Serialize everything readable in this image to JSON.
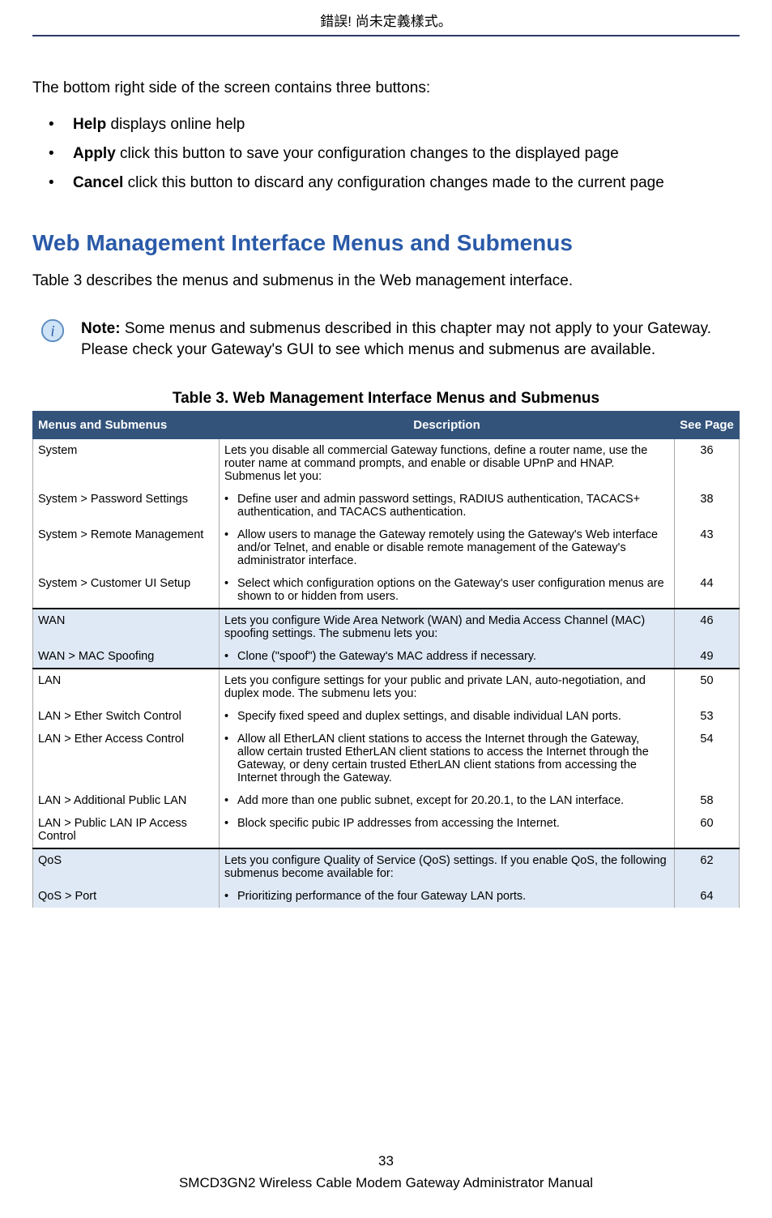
{
  "header": {
    "error_text": "錯誤! 尚未定義樣式。"
  },
  "intro": {
    "line": "The bottom right side of the screen contains three buttons:",
    "items": [
      {
        "bold": "Help",
        "rest": " displays online help"
      },
      {
        "bold": "Apply",
        "rest": " click this button to save your configuration changes to the displayed page"
      },
      {
        "bold": "Cancel",
        "rest": " click this button to discard any configuration changes made to the current page"
      }
    ]
  },
  "section": {
    "title": "Web Management Interface Menus and Submenus",
    "intro": "Table 3 describes the menus and submenus in the Web management interface."
  },
  "note": {
    "bold": "Note:",
    "text": " Some menus and submenus described in this chapter may not apply to your Gateway. Please check your Gateway's GUI to see which menus and submenus are available."
  },
  "table": {
    "caption": "Table 3. Web Management Interface Menus and Submenus",
    "headers": {
      "col1": "Menus and Submenus",
      "col2": "Description",
      "col3": "See Page"
    },
    "rows": [
      {
        "group": "odd",
        "menu": "System",
        "desc": "Lets you disable all commercial Gateway functions, define a router name, use the router name at command prompts, and enable or disable UPnP and HNAP. Submenus let you:",
        "page": "36",
        "bullet": false,
        "start": true
      },
      {
        "group": "odd",
        "menu": "System > Password Settings",
        "desc": "Define user and admin password settings, RADIUS authentication, TACACS+ authentication, and TACACS authentication.",
        "page": "38",
        "bullet": true
      },
      {
        "group": "odd",
        "menu": "System > Remote Management",
        "desc": "Allow users to manage the Gateway remotely using the Gateway's Web interface and/or Telnet, and enable or disable remote management of the Gateway's administrator interface.",
        "page": "43",
        "bullet": true
      },
      {
        "group": "odd",
        "menu": "System > Customer UI Setup",
        "desc": "Select which configuration options on the Gateway's user configuration menus are shown to or hidden from users.",
        "page": "44",
        "bullet": true,
        "sep": true
      },
      {
        "group": "even",
        "menu": "WAN",
        "desc": "Lets you configure Wide Area Network (WAN) and Media Access Channel (MAC) spoofing settings. The submenu lets you:",
        "page": "46",
        "bullet": false,
        "start": true
      },
      {
        "group": "even",
        "menu": "WAN > MAC Spoofing",
        "desc": "Clone (\"spoof\") the Gateway's MAC address if necessary.",
        "page": "49",
        "bullet": true,
        "sep": true
      },
      {
        "group": "odd",
        "menu": "LAN",
        "desc": "Lets you configure settings for your public and private LAN, auto-negotiation, and duplex mode. The submenu lets you:",
        "page": "50",
        "bullet": false,
        "start": true
      },
      {
        "group": "odd",
        "menu": "LAN > Ether Switch Control",
        "desc": "Specify fixed speed and duplex settings, and disable individual LAN ports.",
        "page": "53",
        "bullet": true
      },
      {
        "group": "odd",
        "menu": "LAN > Ether Access Control",
        "desc": "Allow all EtherLAN client stations to access the Internet through the Gateway, allow certain trusted EtherLAN client stations to access the Internet through the Gateway, or deny certain trusted EtherLAN client stations from accessing the Internet through the Gateway.",
        "page": "54",
        "bullet": true
      },
      {
        "group": "odd",
        "menu": "LAN > Additional Public LAN",
        "desc": "Add more than one public subnet, except for 20.20.1, to the LAN interface.",
        "page": "58",
        "bullet": true
      },
      {
        "group": "odd",
        "menu": "LAN > Public LAN IP Access Control",
        "desc": "Block specific pubic IP addresses from accessing the Internet.",
        "page": "60",
        "bullet": true,
        "sep": true
      },
      {
        "group": "even",
        "menu": "QoS",
        "desc": "Lets you configure Quality of Service (QoS) settings. If you enable QoS, the following submenus become available for:",
        "page": "62",
        "bullet": false,
        "start": true
      },
      {
        "group": "even",
        "menu": "QoS > Port",
        "desc": "Prioritizing performance of the four Gateway LAN ports.",
        "page": "64",
        "bullet": true
      }
    ]
  },
  "footer": {
    "page_number": "33",
    "doc_title": "SMCD3GN2 Wireless Cable Modem Gateway Administrator Manual"
  }
}
